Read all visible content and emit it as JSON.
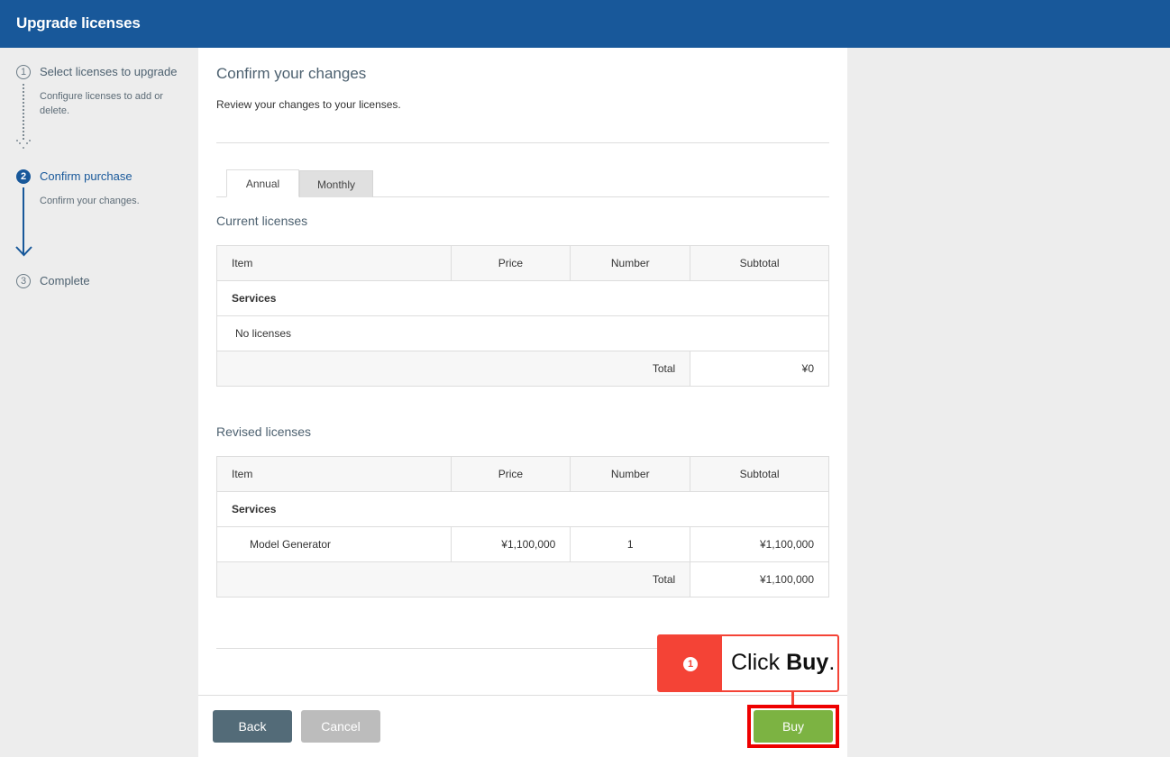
{
  "header": {
    "title": "Upgrade licenses"
  },
  "steps": [
    {
      "number": "1",
      "label": "Select licenses to upgrade",
      "description": "Configure licenses to add or delete.",
      "state": "completed"
    },
    {
      "number": "2",
      "label": "Confirm purchase",
      "description": "Confirm your changes.",
      "state": "active"
    },
    {
      "number": "3",
      "label": "Complete",
      "description": "",
      "state": "upcoming"
    }
  ],
  "main": {
    "title": "Confirm your changes",
    "subtitle": "Review your changes to your licenses.",
    "tabs": [
      {
        "label": "Annual",
        "active": true
      },
      {
        "label": "Monthly",
        "active": false
      }
    ],
    "columns": {
      "item": "Item",
      "price": "Price",
      "number": "Number",
      "subtotal": "Subtotal"
    },
    "current": {
      "title": "Current licenses",
      "group": "Services",
      "empty_text": "No licenses",
      "total_label": "Total",
      "total_value": "¥0"
    },
    "revised": {
      "title": "Revised licenses",
      "group": "Services",
      "rows": [
        {
          "item": "Model Generator",
          "price": "¥1,100,000",
          "number": "1",
          "subtotal": "¥1,100,000"
        }
      ],
      "total_label": "Total",
      "total_value": "¥1,100,000"
    }
  },
  "footer": {
    "back_label": "Back",
    "cancel_label": "Cancel",
    "buy_label": "Buy"
  },
  "callout": {
    "number": "1",
    "text_prefix": "Click ",
    "text_bold": "Buy",
    "text_suffix": "."
  },
  "colors": {
    "header": "#18589a",
    "accent": "#18589a",
    "buy": "#7cb342",
    "back": "#536b78",
    "cancel_disabled": "#bcbcbc",
    "callout": "#f44336",
    "highlight": "#ee0000"
  }
}
